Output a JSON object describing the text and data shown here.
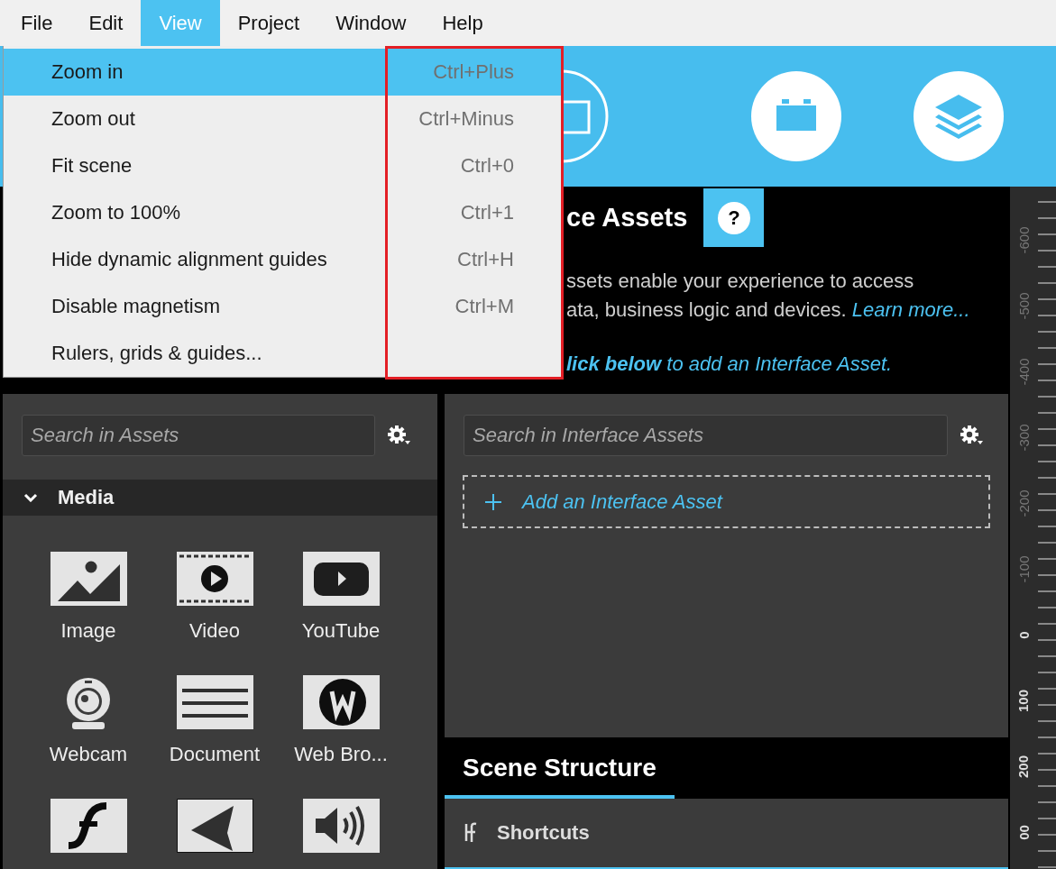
{
  "menubar": [
    {
      "label": "File",
      "selected": false
    },
    {
      "label": "Edit",
      "selected": false
    },
    {
      "label": "View",
      "selected": true
    },
    {
      "label": "Project",
      "selected": false
    },
    {
      "label": "Window",
      "selected": false
    },
    {
      "label": "Help",
      "selected": false
    }
  ],
  "view_menu": {
    "items": [
      {
        "label": "Zoom in",
        "shortcut": "Ctrl+Plus",
        "selected": true
      },
      {
        "label": "Zoom out",
        "shortcut": "Ctrl+Minus",
        "selected": false
      },
      {
        "label": "Fit scene",
        "shortcut": "Ctrl+0",
        "selected": false
      },
      {
        "label": "Zoom to 100%",
        "shortcut": "Ctrl+1",
        "selected": false
      },
      {
        "label": "Hide dynamic alignment guides",
        "shortcut": "Ctrl+H",
        "selected": false
      },
      {
        "label": "Disable magnetism",
        "shortcut": "Ctrl+M",
        "selected": false
      },
      {
        "label": "Rulers, grids & guides...",
        "selected": false
      }
    ]
  },
  "info_panel": {
    "title": "ce Assets",
    "help_label": "?",
    "line_1": "ssets enable your experience to access",
    "line_2": {
      "text": "ata, business logic and devices.",
      "link": "Learn more..."
    },
    "line_3": "**lick below** to add an Interface Asset."
  },
  "assets_panel": {
    "search_placeholder": "Search in Assets",
    "section": {
      "title": "Media",
      "expanded": true
    },
    "items": [
      {
        "kind": "image",
        "label": "Image"
      },
      {
        "kind": "video",
        "label": "Video"
      },
      {
        "kind": "youtube",
        "label": "YouTube"
      },
      {
        "kind": "webcam",
        "label": "Webcam"
      },
      {
        "kind": "document",
        "label": "Document"
      },
      {
        "kind": "web",
        "label": "Web Bro..."
      },
      {
        "kind": "flash"
      },
      {
        "kind": "unity"
      },
      {
        "kind": "audio"
      }
    ]
  },
  "interface_panel": {
    "search_placeholder": "Search in Interface Assets",
    "add_label": "Add an Interface Asset"
  },
  "scene_structure": {
    "tabs": [
      {
        "label": "Scene Structure",
        "selected": true
      }
    ],
    "sections": [
      {
        "label": "Shortcuts"
      }
    ]
  },
  "ruler": {
    "labels": [
      {
        "text": "-600",
        "highlighted": false
      },
      {
        "text": "-500",
        "highlighted": false
      },
      {
        "text": "-400",
        "highlighted": false
      },
      {
        "text": "-300",
        "highlighted": false
      },
      {
        "text": "-200",
        "highlighted": false
      },
      {
        "text": "-100",
        "highlighted": false
      },
      {
        "text": "0",
        "highlighted": true
      },
      {
        "text": "100",
        "highlighted": true
      },
      {
        "text": "200",
        "highlighted": true
      },
      {
        "text": "00",
        "highlighted": true
      }
    ]
  }
}
